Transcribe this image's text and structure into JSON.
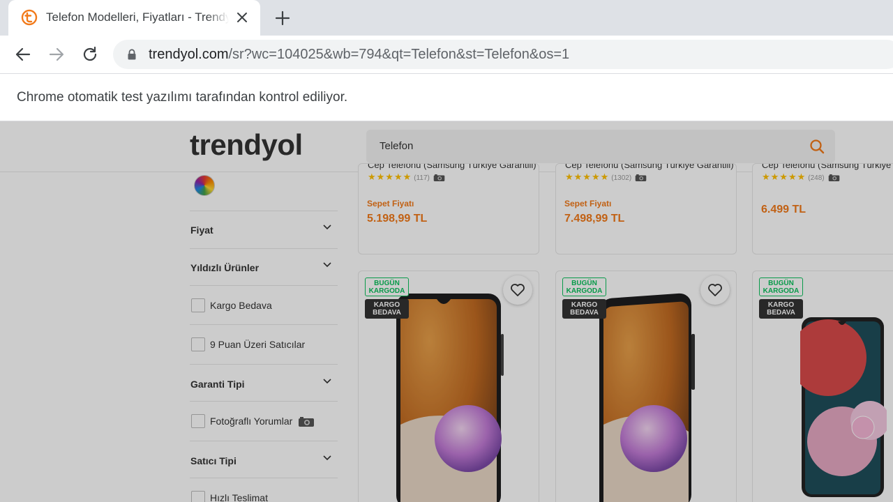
{
  "browser": {
    "tab_title": "Telefon Modelleri, Fiyatları - Trendyol",
    "url_host": "trendyol.com",
    "url_path": "/sr?wc=104025&wb=794&qt=Telefon&st=Telefon&os=1",
    "infobar_text": "Chrome otomatik test yazılımı tarafından kontrol ediliyor."
  },
  "site": {
    "logo": "trendyol",
    "search_value": "Telefon",
    "accent_color": "#f27a1a"
  },
  "sidebar": {
    "filters": [
      {
        "type": "facet",
        "label": "Fiyat"
      },
      {
        "type": "facet",
        "label": "Yıldızlı Ürünler"
      },
      {
        "type": "checkbox",
        "label": "Kargo Bedava",
        "checked": false
      },
      {
        "type": "checkbox",
        "label": "9 Puan Üzeri Satıcılar",
        "checked": false
      },
      {
        "type": "facet",
        "label": "Garanti Tipi"
      },
      {
        "type": "checkbox",
        "label": "Fotoğraflı Yorumlar",
        "checked": false,
        "icon": "camera-icon"
      },
      {
        "type": "facet",
        "label": "Satıcı Tipi"
      },
      {
        "type": "checkbox",
        "label": "Hızlı Teslimat",
        "checked": false
      }
    ]
  },
  "products_top": [
    {
      "name": "Cep Telefonu (Samsung Türkiye Garantili)",
      "stars": "★★★★★",
      "reviews": "(117)",
      "sepet_label": "Sepet Fiyatı",
      "price": "5.198,99 TL"
    },
    {
      "name": "Cep Telefonu (Samsung Türkiye Garantili)",
      "stars": "★★★★★",
      "reviews": "(1302)",
      "sepet_label": "Sepet Fiyatı",
      "price": "7.498,99 TL"
    },
    {
      "name": "Cep Telefonu (Samsung Türkiye Garantili)",
      "stars": "★★★★★",
      "reviews": "(248)",
      "sepet_label": "",
      "price": "6.499 TL"
    }
  ],
  "products_bottom": [
    {
      "badge_1": "BUGÜN KARGODA",
      "badge_2": "KARGO BEDAVA"
    },
    {
      "badge_1": "BUGÜN KARGODA",
      "badge_2": "KARGO BEDAVA"
    },
    {
      "badge_1": "BUGÜN KARGODA",
      "badge_2": "KARGO BEDAVA"
    }
  ]
}
